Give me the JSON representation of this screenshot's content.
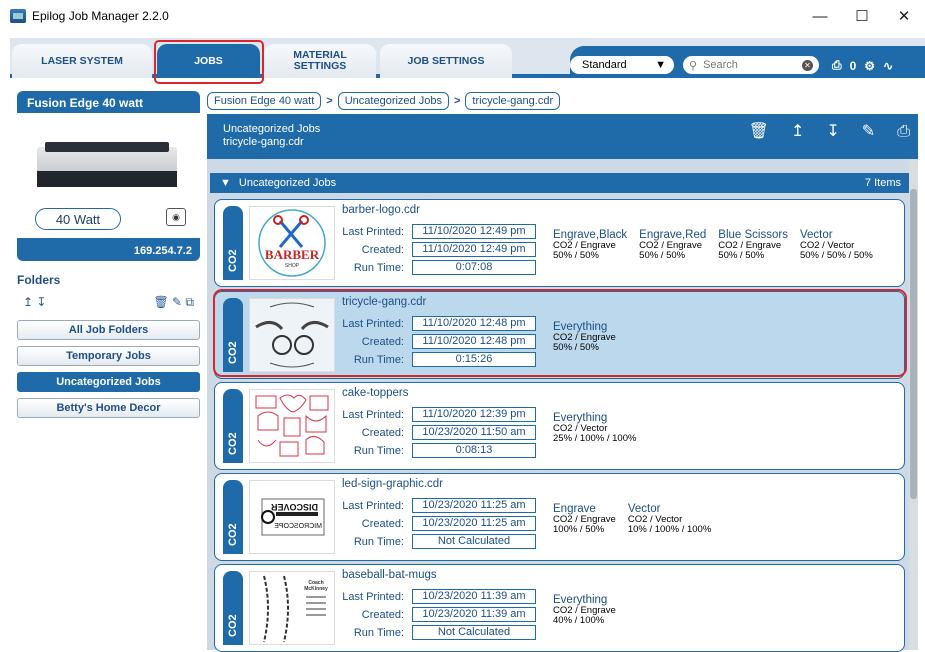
{
  "window": {
    "title": "Epilog Job Manager 2.2.0"
  },
  "tabs": [
    {
      "label": "LASER SYSTEM"
    },
    {
      "label": "JOBS"
    },
    {
      "label": "MATERIAL SETTINGS"
    },
    {
      "label": "JOB SETTINGS"
    }
  ],
  "toolbar": {
    "profile": "Standard",
    "search_placeholder": "Search",
    "queue_count": "0"
  },
  "machine": {
    "name": "Fusion Edge 40 watt",
    "wattage": "40 Watt",
    "ip": "169.254.7.2"
  },
  "folders": {
    "heading": "Folders",
    "items": [
      {
        "label": "All Job Folders"
      },
      {
        "label": "Temporary Jobs"
      },
      {
        "label": "Uncategorized Jobs"
      },
      {
        "label": "Betty's Home Decor"
      }
    ]
  },
  "breadcrumb": [
    "Fusion Edge 40 watt",
    "Uncategorized Jobs",
    "tricycle-gang.cdr"
  ],
  "header": {
    "folder": "Uncategorized Jobs",
    "file": "tricycle-gang.cdr"
  },
  "group": {
    "label": "Uncategorized Jobs",
    "count": "7 Items"
  },
  "labels": {
    "last_printed": "Last Printed:",
    "created": "Created:",
    "run_time": "Run Time:",
    "laser_type": "CO2"
  },
  "jobs": [
    {
      "name": "barber-logo.cdr",
      "last_printed": "11/10/2020 12:49 pm",
      "created": "11/10/2020 12:49 pm",
      "run_time": "0:07:08",
      "modes": [
        {
          "name": "Engrave,Black",
          "type": "CO2 / Engrave",
          "settings": "50% / 50%"
        },
        {
          "name": "Engrave,Red",
          "type": "CO2 / Engrave",
          "settings": "50% / 50%"
        },
        {
          "name": "Blue Scissors",
          "type": "CO2 / Engrave",
          "settings": "50% / 50%"
        },
        {
          "name": "Vector",
          "type": "CO2 / Vector",
          "settings": "50% / 50% / 50%"
        }
      ]
    },
    {
      "name": "tricycle-gang.cdr",
      "last_printed": "11/10/2020 12:48 pm",
      "created": "11/10/2020 12:48 pm",
      "run_time": "0:15:26",
      "modes": [
        {
          "name": "Everything",
          "type": "CO2 / Engrave",
          "settings": "50% / 50%"
        }
      ]
    },
    {
      "name": "cake-toppers",
      "last_printed": "11/10/2020 12:39 pm",
      "created": "10/23/2020 11:50 am",
      "run_time": "0:08:13",
      "modes": [
        {
          "name": "Everything",
          "type": "CO2 / Vector",
          "settings": "25% / 100% / 100%"
        }
      ]
    },
    {
      "name": "led-sign-graphic.cdr",
      "last_printed": "10/23/2020 11:25 am",
      "created": "10/23/2020 11:25 am",
      "run_time": "Not Calculated",
      "modes": [
        {
          "name": "Engrave",
          "type": "CO2 / Engrave",
          "settings": "100% / 50%"
        },
        {
          "name": "Vector",
          "type": "CO2 / Vector",
          "settings": "10% / 100% / 100%"
        }
      ]
    },
    {
      "name": "baseball-bat-mugs",
      "last_printed": "10/23/2020 11:39 am",
      "created": "10/23/2020 11:39 am",
      "run_time": "Not Calculated",
      "modes": [
        {
          "name": "Everything",
          "type": "CO2 / Engrave",
          "settings": "40% / 100%"
        }
      ]
    }
  ],
  "thumbs": {
    "barber_text": "BARBER",
    "barber_sub": "SHOP",
    "led_line1": "DISCOVER",
    "led_line2": "MICROSCOPE",
    "bat_title": "Coach",
    "bat_sub": "McKinney"
  },
  "colors": {
    "accent": "#1f6aa8",
    "highlight": "#d8262c",
    "selected_row": "#bcd8ec"
  }
}
